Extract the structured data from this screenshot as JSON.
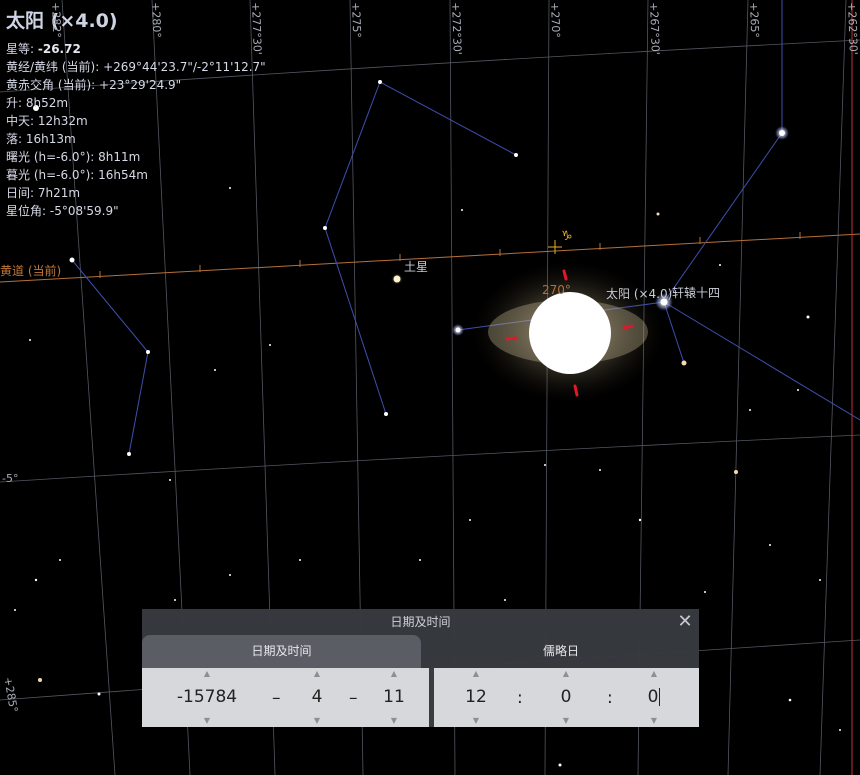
{
  "object": {
    "name": "太阳",
    "magnification": "(×4.0)",
    "rows": [
      {
        "label": "星等: ",
        "value": "-26.72",
        "bold": true
      },
      {
        "label": "黄经/黄纬 (当前): ",
        "value": "+269°44'23.7\"/-2°11'12.7\""
      },
      {
        "label": "黄赤交角 (当前): ",
        "value": "+23°29'24.9\""
      },
      {
        "label": "升: ",
        "value": "8h52m"
      },
      {
        "label": "中天: ",
        "value": "12h32m"
      },
      {
        "label": "落: ",
        "value": "16h13m"
      },
      {
        "label": "曙光 (h=-6.0°): ",
        "value": "8h11m"
      },
      {
        "label": "暮光 (h=-6.0°): ",
        "value": "16h54m"
      },
      {
        "label": "日间: ",
        "value": "7h21m"
      },
      {
        "label": "星位角: ",
        "value": "-5°08'59.9\""
      }
    ]
  },
  "sky_labels": {
    "ecliptic": "黄道 (当前)",
    "saturn": "土星",
    "sun_label": "太阳 (×4.0)",
    "star_label": "轩辕十四",
    "capricorn_symbol": "♑",
    "ecliptic_deg": "270°"
  },
  "grid_labels": {
    "top": [
      "+282°",
      "+280°",
      "+277°30'",
      "+275°",
      "+272°30'",
      "+270°",
      "+267°30'",
      "+265°",
      "+262°30'"
    ],
    "left_mid": "-5°",
    "left_bottom": "+285°"
  },
  "dialog": {
    "title": "日期及时间",
    "tab_active": "日期及时间",
    "tab_inactive": "儒略日",
    "year": "-15784",
    "month": "4",
    "day": "11",
    "hour": "12",
    "minute": "0",
    "second": "0",
    "date_sep": "–",
    "time_sep": ":",
    "close_symbol": "✕"
  },
  "colors": {
    "ecliptic": "#b5703a",
    "grid": "#7a7f8a",
    "constellation": "#3e4fb0",
    "sun_marker": "#e0182a"
  }
}
